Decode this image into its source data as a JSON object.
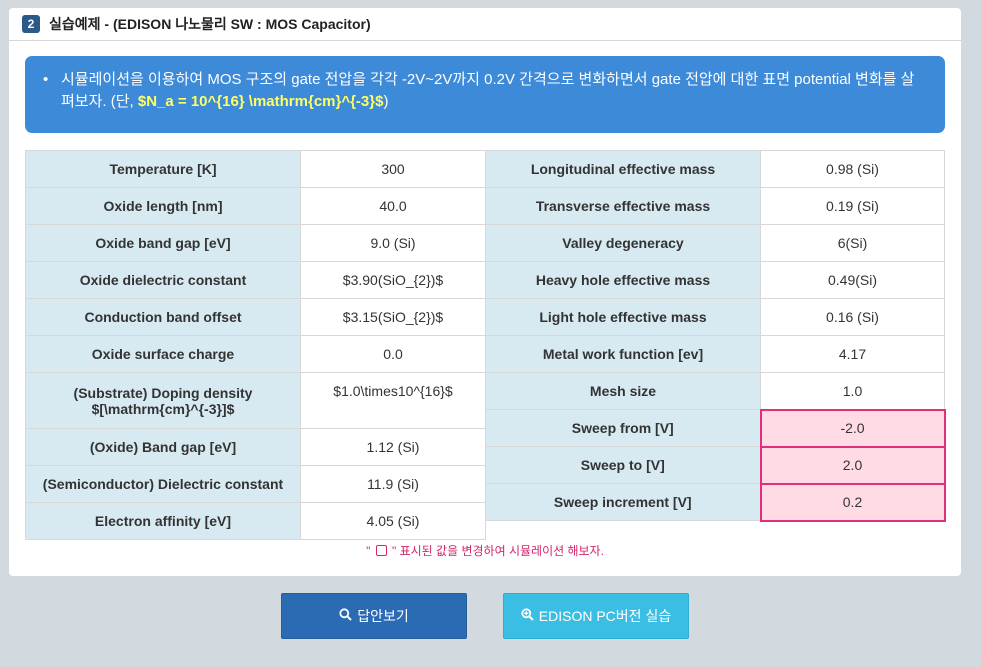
{
  "header": {
    "number": "2",
    "title": "실습예제 - (EDISON 나노물리 SW : MOS Capacitor)"
  },
  "banner": {
    "bullet": "•",
    "text": "시뮬레이션을 이용하여 MOS 구조의 gate 전압을 각각 -2V~2V까지 0.2V 간격으로 변화하면서  gate 전압에 대한 표면 potential 변화를 살펴보자. (단, ",
    "highlight": "$N_a = 10^{16} \\mathrm{cm}^{-3}$",
    "close": ")"
  },
  "left_rows": [
    {
      "label": "Temperature [K]",
      "value": "300"
    },
    {
      "label": "Oxide length [nm]",
      "value": "40.0"
    },
    {
      "label": "Oxide band gap [eV]",
      "value": "9.0 (Si)"
    },
    {
      "label": "Oxide dielectric constant",
      "value": "$3.90(SiO_{2})$"
    },
    {
      "label": "Conduction band offset",
      "value": "$3.15(SiO_{2})$"
    },
    {
      "label": "Oxide surface charge",
      "value": "0.0"
    },
    {
      "label": "(Substrate) Doping density $[\\mathrm{cm}^{-3}]$",
      "value": "$1.0\\times10^{16}$"
    },
    {
      "label": "(Oxide) Band gap [eV]",
      "value": "1.12 (Si)"
    },
    {
      "label": "(Semiconductor) Dielectric constant",
      "value": "11.9 (Si)"
    },
    {
      "label": "Electron affinity [eV]",
      "value": "4.05 (Si)"
    }
  ],
  "right_rows": [
    {
      "label": "Longitudinal effective mass",
      "value": "0.98 (Si)"
    },
    {
      "label": "Transverse effective mass",
      "value": "0.19 (Si)"
    },
    {
      "label": "Valley degeneracy",
      "value": "6(Si)"
    },
    {
      "label": "Heavy hole effective mass",
      "value": "0.49(Si)"
    },
    {
      "label": "Light hole effective mass",
      "value": "0.16 (Si)"
    },
    {
      "label": "Metal work function [ev]",
      "value": "4.17"
    },
    {
      "label": "Mesh size",
      "value": "1.0"
    },
    {
      "label": "Sweep from [V]",
      "value": "-2.0"
    },
    {
      "label": "Sweep to [V]",
      "value": "2.0"
    },
    {
      "label": "Sweep increment [V]",
      "value": "0.2"
    }
  ],
  "note": {
    "before": "\" ",
    "after": " \" 표시된 값을 변경하여 시뮬레이션 해보자."
  },
  "buttons": {
    "answer": "답안보기",
    "edison": "EDISON PC버전 실습"
  }
}
